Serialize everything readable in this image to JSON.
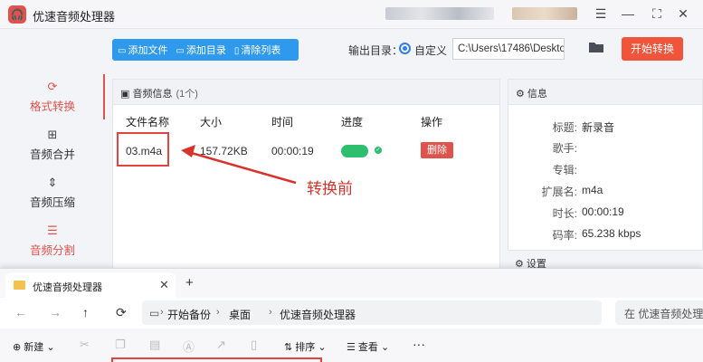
{
  "app": {
    "title": "优速音频处理器",
    "logo_glyph": "🎧",
    "window_controls": {
      "menu": "☰",
      "minimize": "—",
      "maximize": "⛶",
      "close": "✕"
    },
    "toolbar": {
      "add_file": "添加文件",
      "add_dir": "添加目录",
      "clear_list": "清除列表",
      "output_label": "输出目录：",
      "custom_label": "自定义",
      "output_path": "C:\\Users\\17486\\Deskto",
      "start": "开始转换"
    },
    "sidebar": [
      {
        "label": "格式转换",
        "icon": "refresh-icon",
        "glyph": "⟳",
        "active": true
      },
      {
        "label": "音频合并",
        "icon": "merge-icon",
        "glyph": "⊞",
        "active": false
      },
      {
        "label": "音频压缩",
        "icon": "compress-icon",
        "glyph": "⇕",
        "active": false
      },
      {
        "label": "音频分割",
        "icon": "split-icon",
        "glyph": "☰",
        "active": false
      }
    ],
    "list": {
      "header": "音频信息",
      "count": "(1个)",
      "columns": [
        "文件名称",
        "大小",
        "时间",
        "进度",
        "操作"
      ],
      "row": {
        "name": "03.m4a",
        "size": "157.72KB",
        "time": "00:00:19",
        "action": "删除"
      }
    },
    "info": {
      "header": "信息",
      "rows": [
        {
          "k": "标题:",
          "v": "新录音"
        },
        {
          "k": "歌手:",
          "v": ""
        },
        {
          "k": "专辑:",
          "v": ""
        },
        {
          "k": "扩展名:",
          "v": "m4a"
        },
        {
          "k": "时长:",
          "v": "00:00:19"
        },
        {
          "k": "码率:",
          "v": "65.238 kbps"
        }
      ],
      "settings_header": "设置"
    },
    "annotation": "转换前"
  },
  "explorer": {
    "tab_title": "优速音频处理器",
    "address": [
      "开始备份",
      "桌面",
      "优速音频处理器"
    ],
    "search_placeholder": "在 优速音频处理",
    "new_label": "新建",
    "sort_label": "排序",
    "view_label": "查看",
    "more": "···"
  },
  "colors": {
    "accent": "#e0524c",
    "primary": "#2f99ee",
    "start": "#f0543a",
    "progress": "#2bbf6e",
    "annotation": "#d7332c"
  }
}
